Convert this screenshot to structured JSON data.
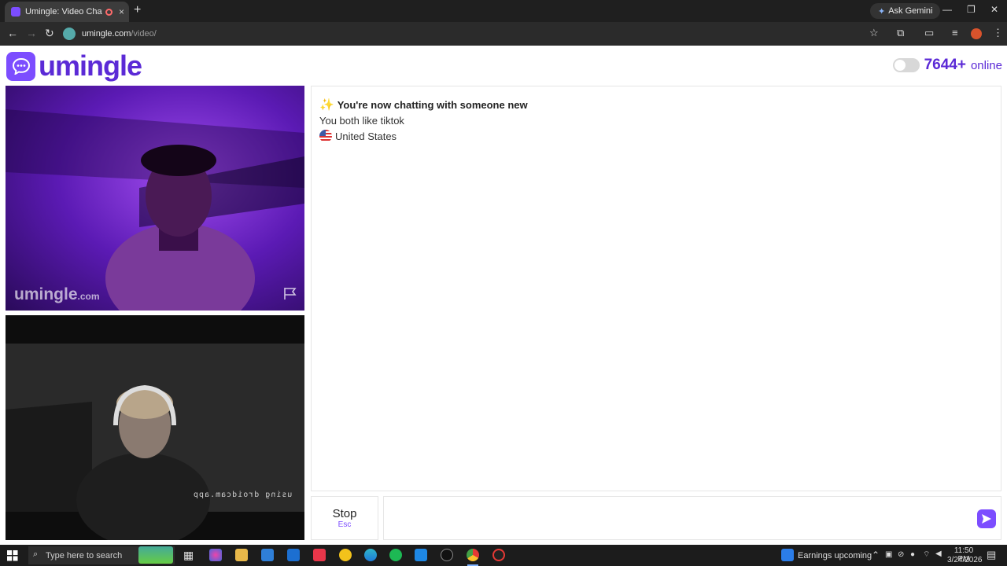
{
  "browser": {
    "tab_title": "Umingle: Video Chat with S",
    "close_tab": "×",
    "new_tab": "+",
    "gemini_label": "Ask Gemini",
    "url_host": "umingle.com",
    "url_path": "/video/"
  },
  "page": {
    "logo_text": "umingle",
    "online_count": "7644+",
    "online_label": "online",
    "video_watermark": "umingle",
    "video_watermark_domain": ".com",
    "local_overlay_text": "using droidcam.app",
    "chat": {
      "title": "You're now chatting with someone new",
      "interests": "You both like tiktok",
      "country": "United States"
    },
    "stop_label": "Stop",
    "stop_key": "Esc",
    "message_placeholder": ""
  },
  "taskbar": {
    "search_placeholder": "Type here to search",
    "news_label": "Earnings upcoming",
    "time": "11:50 PM",
    "date": "3/24/2026"
  },
  "colors": {
    "brand": "#5b2ad6",
    "accent": "#7c4dff"
  }
}
